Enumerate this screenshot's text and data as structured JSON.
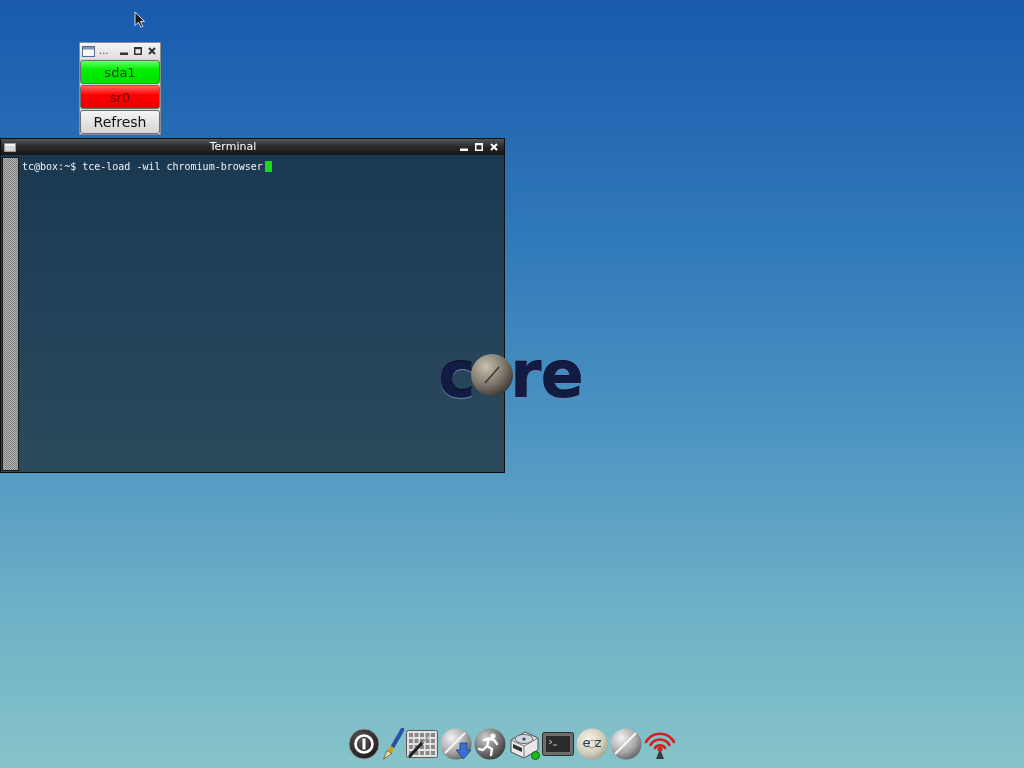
{
  "mount_window": {
    "title": "...",
    "drives": [
      {
        "label": "sda1",
        "mounted": true
      },
      {
        "label": "sr0",
        "mounted": false
      }
    ],
    "refresh_button": "Refresh"
  },
  "terminal": {
    "title": "Terminal",
    "lines": [
      "tc@box:~$ tce-load -wil chromium-browser"
    ]
  },
  "wallpaper_logo": {
    "left_text": "c",
    "right_text": "re"
  },
  "dock": [
    {
      "kind": "power"
    },
    {
      "kind": "brush"
    },
    {
      "kind": "control-panel"
    },
    {
      "kind": "apps"
    },
    {
      "kind": "run"
    },
    {
      "kind": "mount"
    },
    {
      "kind": "terminal"
    },
    {
      "kind": "disc",
      "label": "e z"
    },
    {
      "kind": "sphere"
    },
    {
      "kind": "wifi"
    }
  ]
}
